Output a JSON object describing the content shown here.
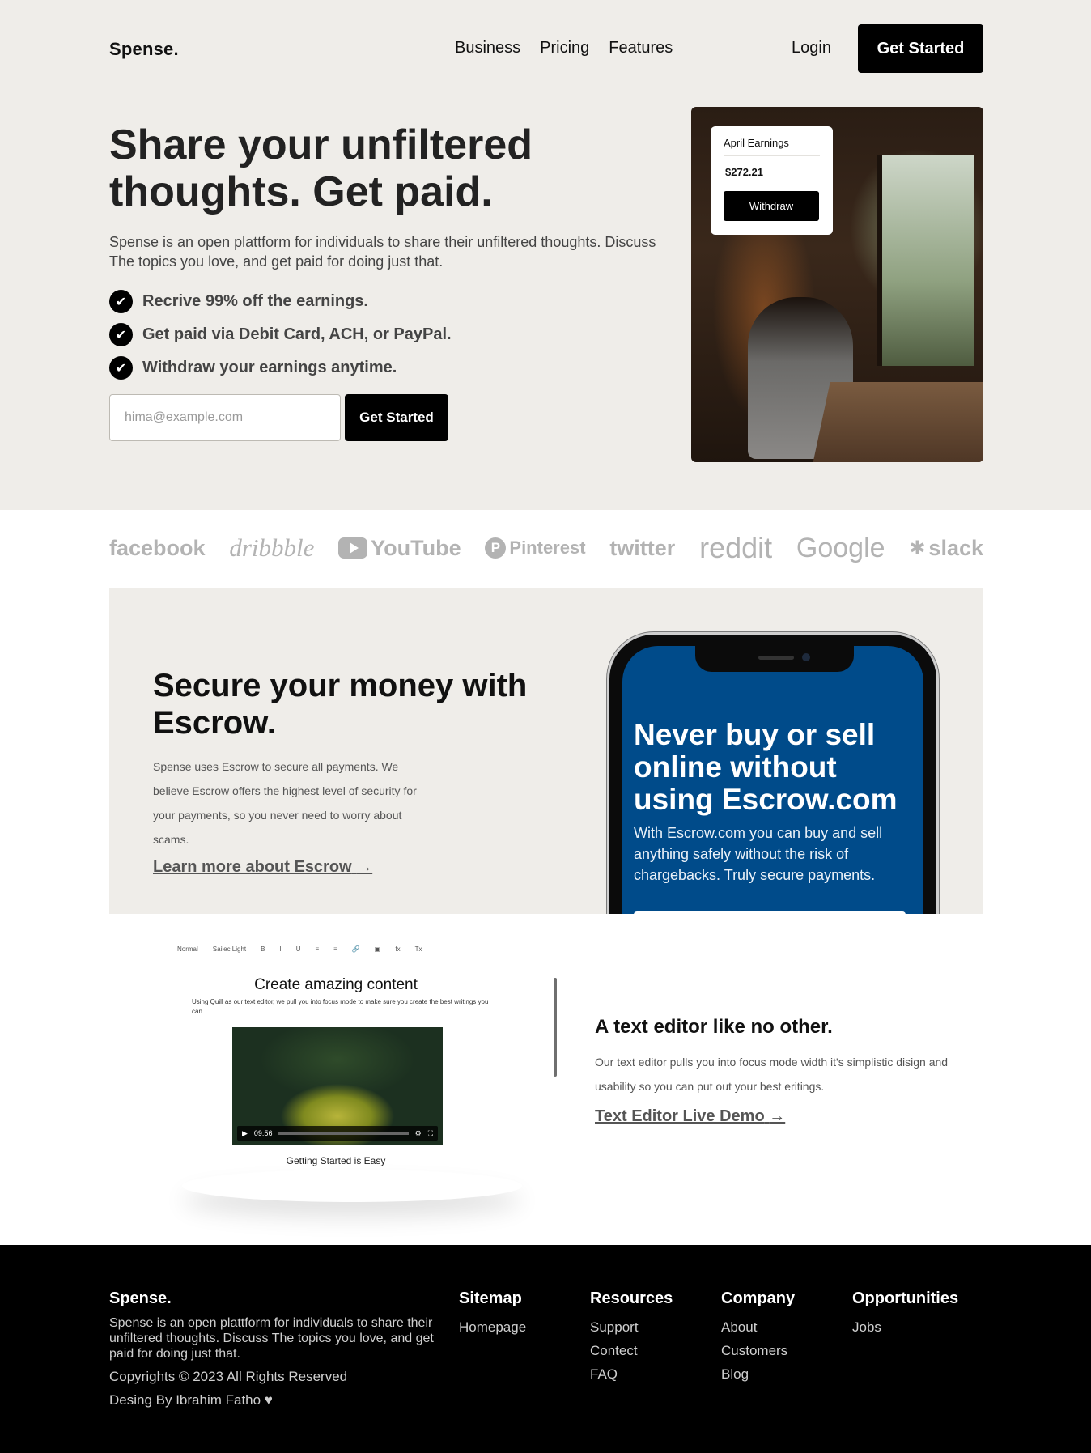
{
  "nav": {
    "logo": "Spense.",
    "links": [
      "Business",
      "Pricing",
      "Features"
    ],
    "login": "Login",
    "cta": "Get Started"
  },
  "hero": {
    "title": "Share your unfiltered thoughts. Get paid.",
    "subtitle": "Spense is an open plattform for individuals to share their unfiltered thoughts. Discuss The topics you love, and get paid for doing just that.",
    "features": [
      "Recrive 99% off the earnings.",
      "Get paid via Debit Card, ACH, or PayPal.",
      "Withdraw your earnings anytime."
    ],
    "email_placeholder": "hima@example.com",
    "cta": "Get Started",
    "card": {
      "title": "April Earnings",
      "amount": "$272.21",
      "button": "Withdraw"
    }
  },
  "logos": [
    "facebook",
    "dribbble",
    "YouTube",
    "Pinterest",
    "twitter",
    "reddit",
    "Google",
    "slack"
  ],
  "escrow": {
    "title": "Secure your money with Escrow.",
    "text": "Spense uses Escrow to secure all payments. We believe Escrow offers the highest level of security for your payments, so you never need to worry about scams.",
    "link": "Learn more about Escrow",
    "phone_headline": "Never buy or sell online without using Escrow.com",
    "phone_body": "With Escrow.com you can buy and sell anything safely without the risk of chargebacks. Truly secure payments."
  },
  "editor": {
    "toolbar": [
      "Normal",
      "Sailec Light",
      "B",
      "I",
      "U",
      "≡",
      "≡",
      "🔗",
      "▣",
      "fx",
      "Tx"
    ],
    "preview_heading": "Create amazing content",
    "preview_text": "Using Quill as our text editor, we pull you into focus mode to make sure you create the best writings you can.",
    "video_time": "09:56",
    "preview_caption": "Getting Started is Easy",
    "title": "A text editor like no other.",
    "text": "Our text editor pulls you into focus mode width it's simplistic disign and usability so you can put out your best eritings.",
    "link": "Text Editor Live Demo"
  },
  "footer": {
    "logo": "Spense.",
    "description": "Spense is an open plattform for individuals to share their unfiltered thoughts. Discuss The topics you love, and get paid for doing just that.",
    "copyright": "Copyrights © 2023 All Rights Reserved",
    "designer": "Desing By Ibrahim Fatho ♥",
    "columns": [
      {
        "title": "Sitemap",
        "links": [
          "Homepage"
        ]
      },
      {
        "title": "Resources",
        "links": [
          "Support",
          "Contect",
          "FAQ"
        ]
      },
      {
        "title": "Company",
        "links": [
          "About",
          "Customers",
          "Blog"
        ]
      },
      {
        "title": "Opportunities",
        "links": [
          "Jobs"
        ]
      }
    ]
  }
}
